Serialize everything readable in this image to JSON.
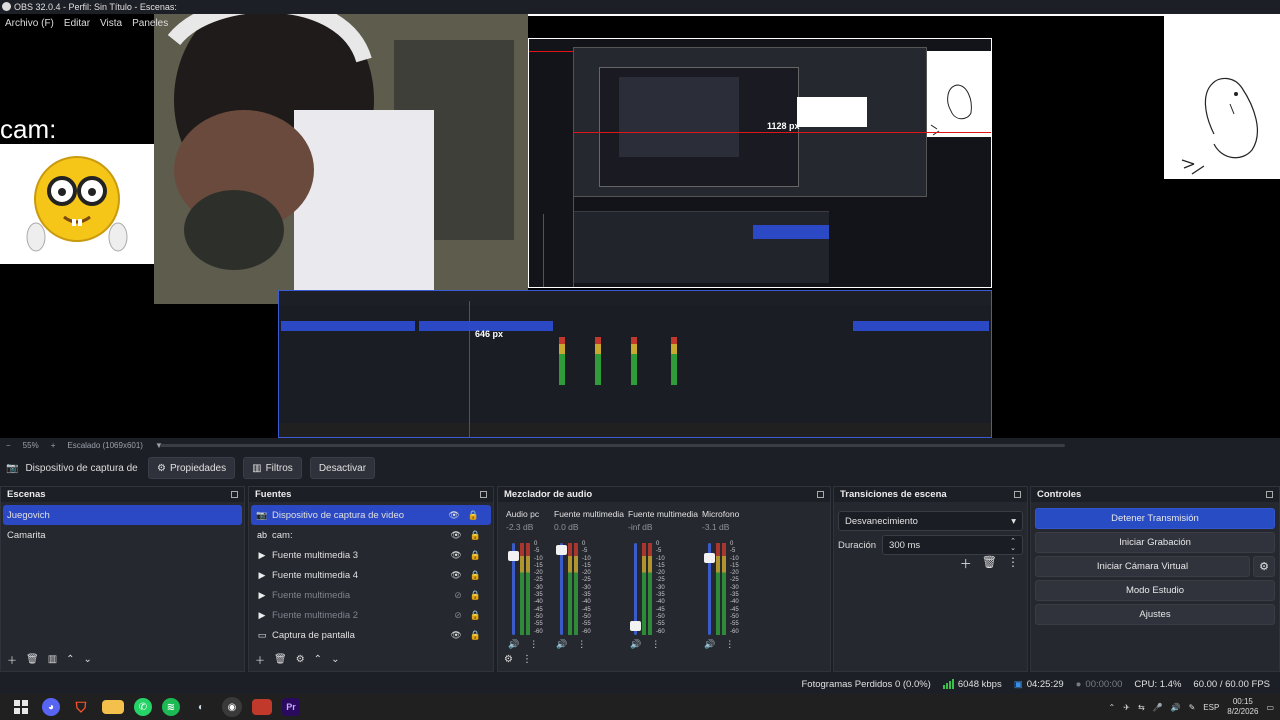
{
  "window": {
    "title": "OBS 32.0.4 - Perfil: Sin Título - Escenas:"
  },
  "menu": [
    "Archivo (F)",
    "Editar",
    "Vista",
    "Paneles"
  ],
  "preview": {
    "cam_label": "cam:",
    "measure_1128": "1128 px",
    "measure_646": "646 px"
  },
  "zoom": {
    "value": "55%",
    "scaled": "Escalado (1069x601)"
  },
  "source_toolbar": {
    "source_name": "Dispositivo de captura de v",
    "properties_label": "Propiedades",
    "filters_label": "Filtros",
    "deactivate_label": "Desactivar"
  },
  "scenes": {
    "title": "Escenas",
    "items": [
      "Juegovich",
      "Camarita"
    ],
    "selected": 0
  },
  "sources": {
    "title": "Fuentes",
    "items": [
      {
        "name": "Dispositivo de captura de video",
        "icon": "camera-icon",
        "visible": true,
        "selected": true
      },
      {
        "name": "cam:",
        "icon": "text-icon",
        "visible": true,
        "selected": false
      },
      {
        "name": "Fuente multimedia 3",
        "icon": "play-icon",
        "visible": true,
        "selected": false
      },
      {
        "name": "Fuente multimedia 4",
        "icon": "play-icon",
        "visible": true,
        "selected": false
      },
      {
        "name": "Fuente multimedia",
        "icon": "play-icon",
        "visible": false,
        "selected": false
      },
      {
        "name": "Fuente multimedia 2",
        "icon": "play-icon",
        "visible": false,
        "selected": false
      },
      {
        "name": "Captura de pantalla",
        "icon": "monitor-icon",
        "visible": true,
        "selected": false
      }
    ]
  },
  "mixer": {
    "title": "Mezclador de audio",
    "channels": [
      {
        "name": "Audio pc",
        "db": "-2.3 dB",
        "level": 0.85
      },
      {
        "name": "Fuente multimedia",
        "db": "0.0 dB",
        "level": 0.9
      },
      {
        "name": "Fuente multimedia",
        "db": "-inf dB",
        "level": 0.05
      },
      {
        "name": "Microfono",
        "db": "-3.1 dB",
        "level": 0.82
      }
    ],
    "scale": [
      "0",
      "-5",
      "-10",
      "-15",
      "-20",
      "-25",
      "-30",
      "-35",
      "-40",
      "-45",
      "-50",
      "-55",
      "-60"
    ]
  },
  "transitions": {
    "title": "Transiciones de escena",
    "selected": "Desvanecimiento",
    "duration_label": "Duración",
    "duration_value": "300 ms"
  },
  "controls": {
    "title": "Controles",
    "stop_stream": "Detener Transmisión",
    "start_recording": "Iniciar Grabación",
    "start_virtual_cam": "Iniciar Cámara Virtual",
    "studio_mode": "Modo Estudio",
    "settings": "Ajustes"
  },
  "status": {
    "dropped_frames": "Fotogramas Perdidos 0 (0.0%)",
    "bitrate": "6048 kbps",
    "stream_time": "04:25:29",
    "rec_time": "00:00:00",
    "cpu": "CPU: 1.4%",
    "fps": "60.00 / 60.00 FPS"
  },
  "taskbar": {
    "lang": "ESP",
    "time": "00:15",
    "date": "8/2/2026"
  },
  "colors": {
    "accent": "#284cc4",
    "panel": "#262830",
    "background": "#1d1f26"
  }
}
